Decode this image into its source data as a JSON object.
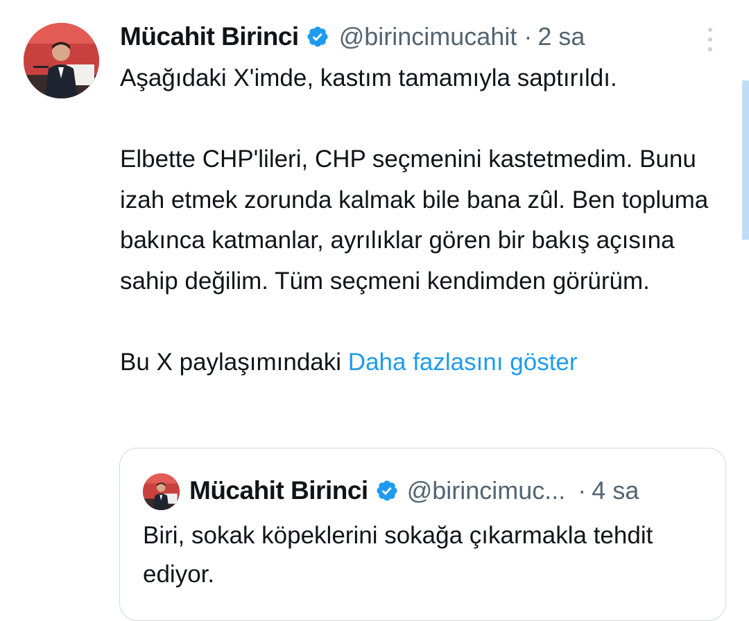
{
  "tweet": {
    "author_name": "Mücahit Birinci",
    "handle": "@birincimucahit",
    "separator": "·",
    "time": "2 sa",
    "paragraphs": [
      "Aşağıdaki X'imde, kastım tamamıyla saptırıldı.",
      "Elbette CHP'lileri, CHP seçmenini kastetmedim. Bunu izah etmek zorunda kalmak bile bana zûl. Ben topluma bakınca katmanlar, ayrılıklar gören bir bakış açısına sahip değilim. Tüm seçmeni kendimden görürüm.",
      "Bu X paylaşımındaki"
    ],
    "show_more": "Daha fazlasını göster",
    "avatar_icon": "profile-photo",
    "verified_icon": "verified-badge-icon",
    "more_icon": "more-vertical-icon"
  },
  "quote": {
    "author_name": "Mücahit Birinci",
    "handle": "@birincimuc...",
    "separator": "·",
    "time": "4 sa",
    "text": "Biri, sokak köpeklerini sokağa çıkarmakla tehdit ediyor."
  },
  "colors": {
    "text": "#0f1419",
    "secondary": "#536471",
    "link": "#1d9bf0",
    "verified": "#1d9bf0",
    "border": "#cfd9de"
  }
}
